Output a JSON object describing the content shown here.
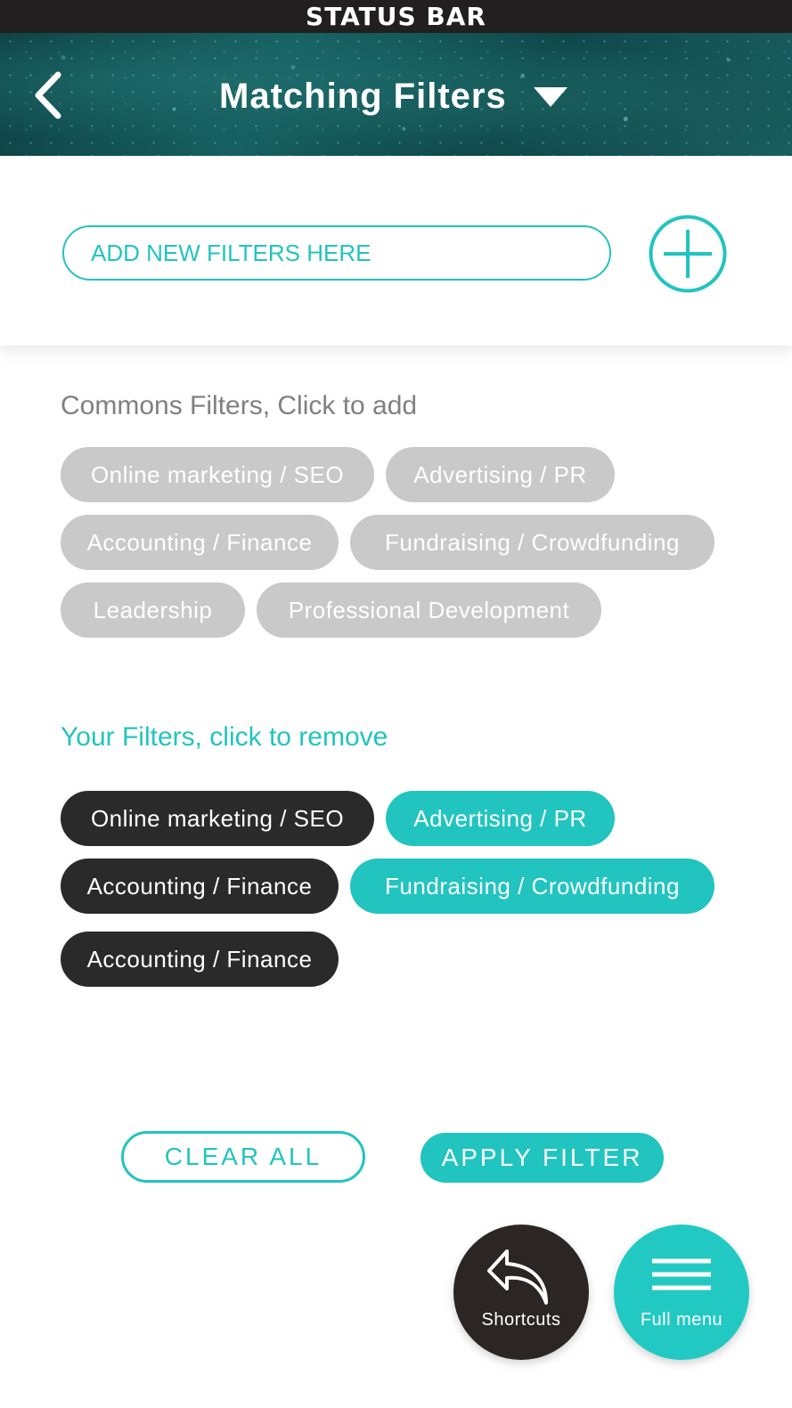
{
  "status_bar": {
    "label": "STATUS BAR"
  },
  "header": {
    "back_icon": "chevron-left-icon",
    "title": "Matching Filters",
    "dropdown_icon": "caret-down-icon"
  },
  "add_filter": {
    "placeholder": "ADD NEW FILTERS HERE",
    "value": "",
    "add_icon": "plus-circle-icon"
  },
  "common_filters": {
    "title": "Commons Filters, Click to add",
    "items": [
      {
        "label": "Online marketing / SEO"
      },
      {
        "label": "Advertising / PR"
      },
      {
        "label": "Accounting / Finance"
      },
      {
        "label": "Fundraising / Crowdfunding"
      },
      {
        "label": "Leadership"
      },
      {
        "label": "Professional Development"
      }
    ]
  },
  "your_filters": {
    "title": "Your Filters, click to remove",
    "items": [
      {
        "label": "Online marketing / SEO",
        "style": "dark"
      },
      {
        "label": "Advertising / PR",
        "style": "teal"
      },
      {
        "label": "Accounting / Finance",
        "style": "dark"
      },
      {
        "label": "Fundraising / Crowdfunding",
        "style": "teal"
      },
      {
        "label": "Accounting / Finance",
        "style": "dark"
      }
    ]
  },
  "actions": {
    "clear_label": "CLEAR ALL",
    "apply_label": "APPLY FILTER"
  },
  "fabs": {
    "shortcuts_label": "Shortcuts",
    "shortcuts_icon": "reply-arrow-icon",
    "menu_label": "Full menu",
    "menu_icon": "hamburger-icon"
  },
  "colors": {
    "accent": "#22c4bf",
    "dark_chip": "#2b2a2a",
    "gray_chip": "#c9c9c9",
    "status_bar": "#231f20"
  }
}
